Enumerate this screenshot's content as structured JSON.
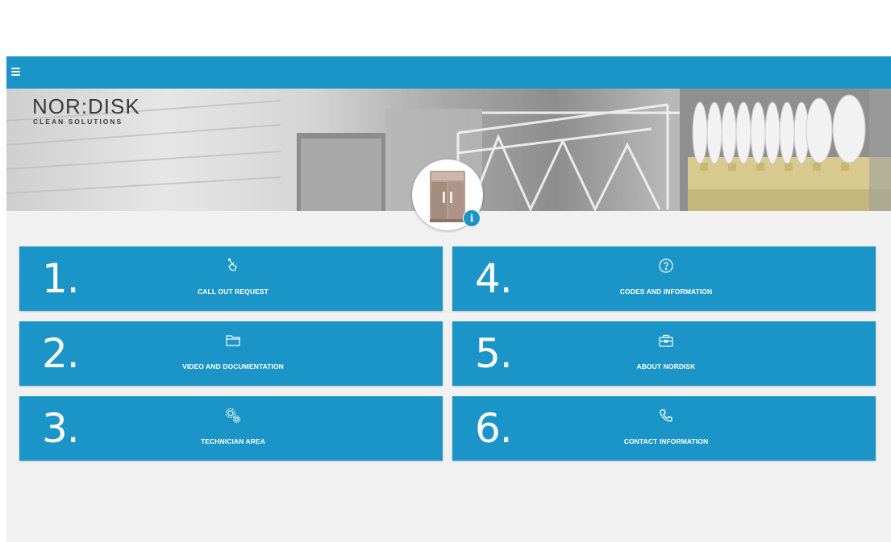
{
  "header": {
    "menu_icon": "hamburger-menu-icon",
    "bar_color": "#1b95c8"
  },
  "hero": {
    "logo_main": "NOR:DISK",
    "logo_sub": "CLEAN SOLUTIONS",
    "info_label": "i"
  },
  "tiles": [
    {
      "number": "1.",
      "label": "CALL OUT REQUEST",
      "icon": "hand-pointer-icon"
    },
    {
      "number": "2.",
      "label": "VIDEO AND DOCUMENTATION",
      "icon": "folder-icon"
    },
    {
      "number": "3.",
      "label": "TECHNICIAN AREA",
      "icon": "gears-icon"
    },
    {
      "number": "4.",
      "label": "CODES AND INFORMATION",
      "icon": "question-circle-icon"
    },
    {
      "number": "5.",
      "label": "ABOUT NORDISK",
      "icon": "briefcase-icon"
    },
    {
      "number": "6.",
      "label": "CONTACT INFORMATION",
      "icon": "phone-icon"
    }
  ],
  "colors": {
    "accent": "#1b95c8",
    "background": "#f1f1f1",
    "tile_text": "#ffffff"
  }
}
